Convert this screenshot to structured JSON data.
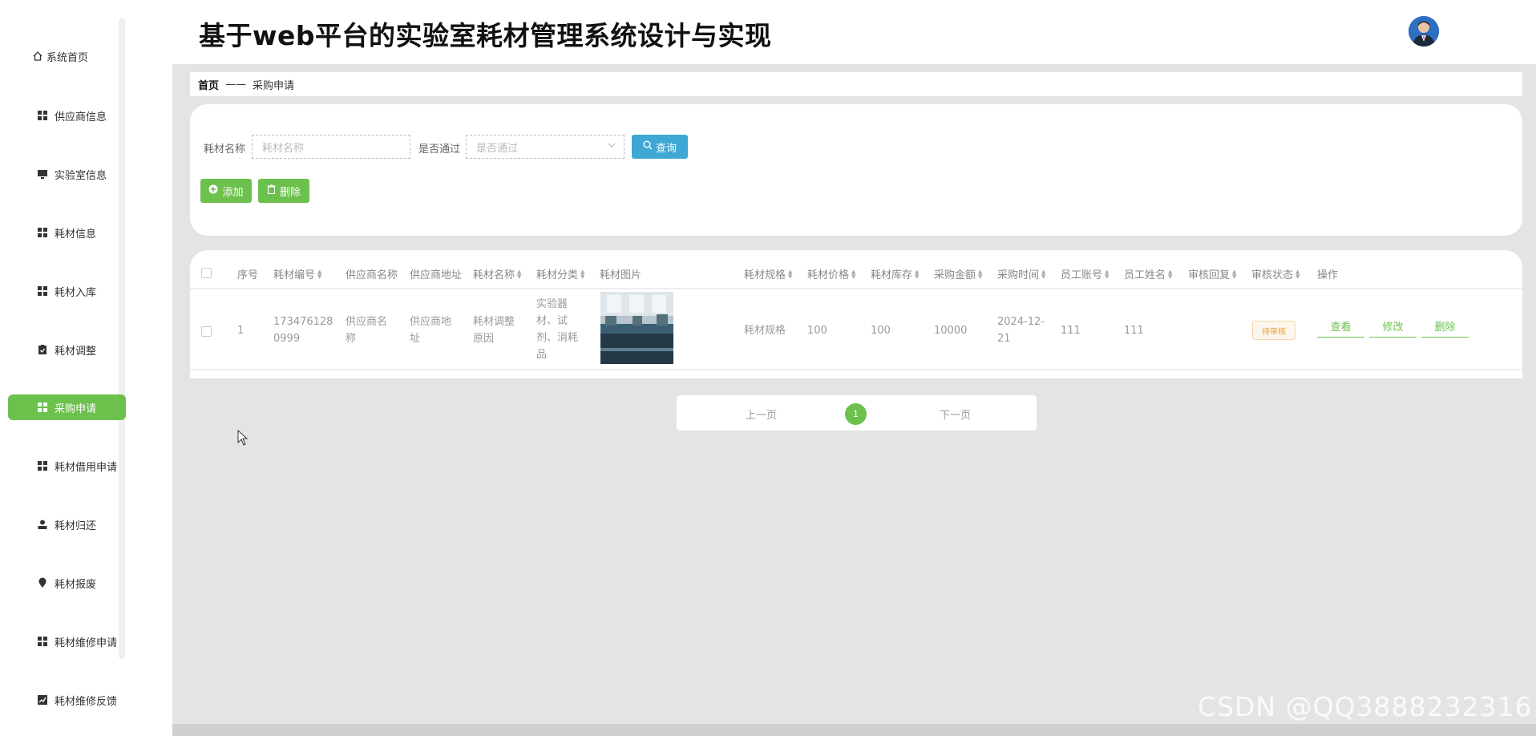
{
  "header": {
    "title": "基于web平台的实验室耗材管理系统设计与实现"
  },
  "sidebar": {
    "items": [
      {
        "label": "系统首页",
        "icon": "home-icon"
      },
      {
        "label": "供应商信息",
        "icon": "grid-icon"
      },
      {
        "label": "实验室信息",
        "icon": "monitor-icon"
      },
      {
        "label": "耗材信息",
        "icon": "grid-icon"
      },
      {
        "label": "耗材入库",
        "icon": "grid-icon"
      },
      {
        "label": "耗材调整",
        "icon": "clipboard-icon"
      },
      {
        "label": "采购申请",
        "icon": "grid-icon",
        "active": true
      },
      {
        "label": "耗材借用申请",
        "icon": "grid-icon"
      },
      {
        "label": "耗材归还",
        "icon": "user-icon"
      },
      {
        "label": "耗材报废",
        "icon": "pin-icon"
      },
      {
        "label": "耗材维修申请",
        "icon": "grid-icon"
      },
      {
        "label": "耗材维修反馈",
        "icon": "chart-icon"
      }
    ]
  },
  "breadcrumb": {
    "home": "首页",
    "separator": "——",
    "current": "采购申请"
  },
  "search": {
    "name_label": "耗材名称",
    "name_placeholder": "耗材名称",
    "pass_label": "是否通过",
    "pass_placeholder": "是否通过",
    "query_button": "查询"
  },
  "actions": {
    "add": "添加",
    "delete": "删除"
  },
  "table": {
    "headers": [
      "序号",
      "耗材编号",
      "供应商名称",
      "供应商地址",
      "耗材名称",
      "耗材分类",
      "耗材图片",
      "耗材规格",
      "耗材价格",
      "耗材库存",
      "采购金额",
      "采购时间",
      "员工账号",
      "员工姓名",
      "审核回复",
      "审核状态",
      "操作"
    ],
    "rows": [
      {
        "index": "1",
        "code": "1734761280999",
        "code_l1": "173476128",
        "code_l2": "0999",
        "supplier_name_l1": "供应商名",
        "supplier_name_l2": "称",
        "supplier_addr_l1": "供应商地",
        "supplier_addr_l2": "址",
        "item_name_l1": "耗材调整",
        "item_name_l2": "原因",
        "category_l1": "实验器",
        "category_l2": "材、试",
        "category_l3": "剂、消耗",
        "category_l4": "品",
        "spec": "耗材规格",
        "price": "100",
        "stock": "100",
        "amount": "10000",
        "time_l1": "2024-12-",
        "time_l2": "21",
        "emp_account": "111",
        "emp_name": "111",
        "reply": "",
        "status": "待审核",
        "ops": {
          "view": "查看",
          "edit": "修改",
          "delete": "删除"
        }
      }
    ]
  },
  "pagination": {
    "prev": "上一页",
    "current": "1",
    "next": "下一页"
  },
  "watermark": "CSDN @QQ3888232316",
  "colors": {
    "accent": "#6cc14c",
    "query": "#3fa7d3",
    "status": "#e6a23c"
  }
}
